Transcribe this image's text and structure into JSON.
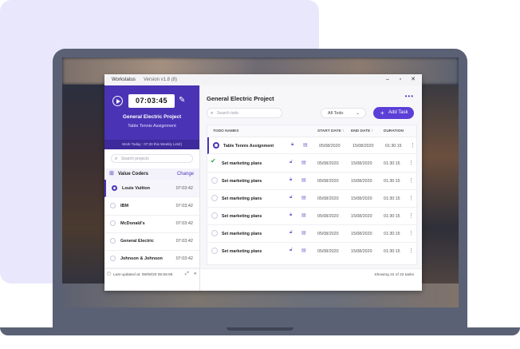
{
  "colors": {
    "accent": "#4a33b5",
    "button": "#5b3fd6",
    "done": "#2aa845",
    "background_card": "#e9e7fc"
  },
  "window": {
    "app_name": "Workstatus",
    "version": "Version v1.8 (8)"
  },
  "timer": {
    "time": "07:03:45",
    "project": "General Electric Project",
    "task": "Table Tennis Assignment",
    "work_today": "Work Today : 07:30 this Weekly Limit)"
  },
  "projects_panel": {
    "search_placeholder": "Search projects",
    "org_name": "Value Coders",
    "change_label": "Change",
    "items": [
      {
        "name": "Louis Vuitton",
        "time": "07:03:42",
        "active": true
      },
      {
        "name": "IBM",
        "time": "07:03:42",
        "active": false
      },
      {
        "name": "McDonald's",
        "time": "07:03:42",
        "active": false
      },
      {
        "name": "General Electric",
        "time": "07:03:42",
        "active": false
      },
      {
        "name": "Johnson & Johnson",
        "time": "07:03:42",
        "active": false
      }
    ]
  },
  "main": {
    "title": "General Electric Project",
    "search_placeholder": "Search todo",
    "filter_value": "All Todo",
    "add_button": "Add Task",
    "columns": [
      "TODO NAMES",
      "START DATE ↑",
      "END DATE ↑",
      "DURATION"
    ],
    "rows": [
      {
        "name": "Table Tennis Assignment",
        "start": "05/08/2020",
        "end": "15/08/2020",
        "duration": "01:30:15",
        "status": "active"
      },
      {
        "name": "Set marketing plans",
        "start": "05/08/2020",
        "end": "15/08/2020",
        "duration": "01:30:15",
        "status": "done"
      },
      {
        "name": "Set marketing plans",
        "start": "05/08/2020",
        "end": "15/08/2020",
        "duration": "01:30:15",
        "status": "todo"
      },
      {
        "name": "Set marketing plans",
        "start": "05/08/2020",
        "end": "15/08/2020",
        "duration": "01:30:15",
        "status": "todo"
      },
      {
        "name": "Set marketing plans",
        "start": "05/08/2020",
        "end": "15/08/2020",
        "duration": "01:30:15",
        "status": "todo"
      },
      {
        "name": "Set marketing plans",
        "start": "05/08/2020",
        "end": "15/08/2020",
        "duration": "01:30:15",
        "status": "todo"
      },
      {
        "name": "Set marketing plans",
        "start": "05/08/2020",
        "end": "15/08/2020",
        "duration": "01:30:15",
        "status": "todo"
      }
    ]
  },
  "footer": {
    "last_updated": "Last updated at: 08/08/20  05:56:65",
    "showing": "Showing 22 of 22 tasks"
  }
}
